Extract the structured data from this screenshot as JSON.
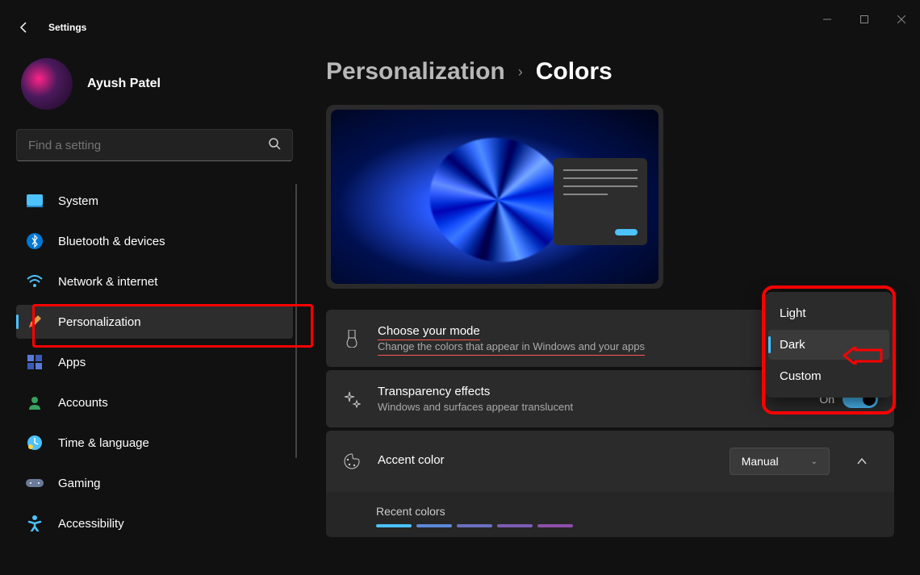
{
  "app_title": "Settings",
  "user_name": "Ayush Patel",
  "search_placeholder": "Find a setting",
  "breadcrumb": {
    "parent": "Personalization",
    "current": "Colors"
  },
  "nav": [
    {
      "label": "System"
    },
    {
      "label": "Bluetooth & devices"
    },
    {
      "label": "Network & internet"
    },
    {
      "label": "Personalization"
    },
    {
      "label": "Apps"
    },
    {
      "label": "Accounts"
    },
    {
      "label": "Time & language"
    },
    {
      "label": "Gaming"
    },
    {
      "label": "Accessibility"
    }
  ],
  "choose_mode": {
    "title": "Choose your mode",
    "sub": "Change the colors that appear in Windows and your apps"
  },
  "mode_menu": {
    "options": [
      "Light",
      "Dark",
      "Custom"
    ],
    "selected": "Dark"
  },
  "transparency": {
    "title": "Transparency effects",
    "sub": "Windows and surfaces appear translucent",
    "value": "On"
  },
  "accent": {
    "title": "Accent color",
    "dropdown": "Manual",
    "recent_label": "Recent colors",
    "swatches": [
      "#4cc2ff",
      "#5c89d8",
      "#6a6fbf",
      "#7c5cb3",
      "#8e4fa8"
    ]
  }
}
